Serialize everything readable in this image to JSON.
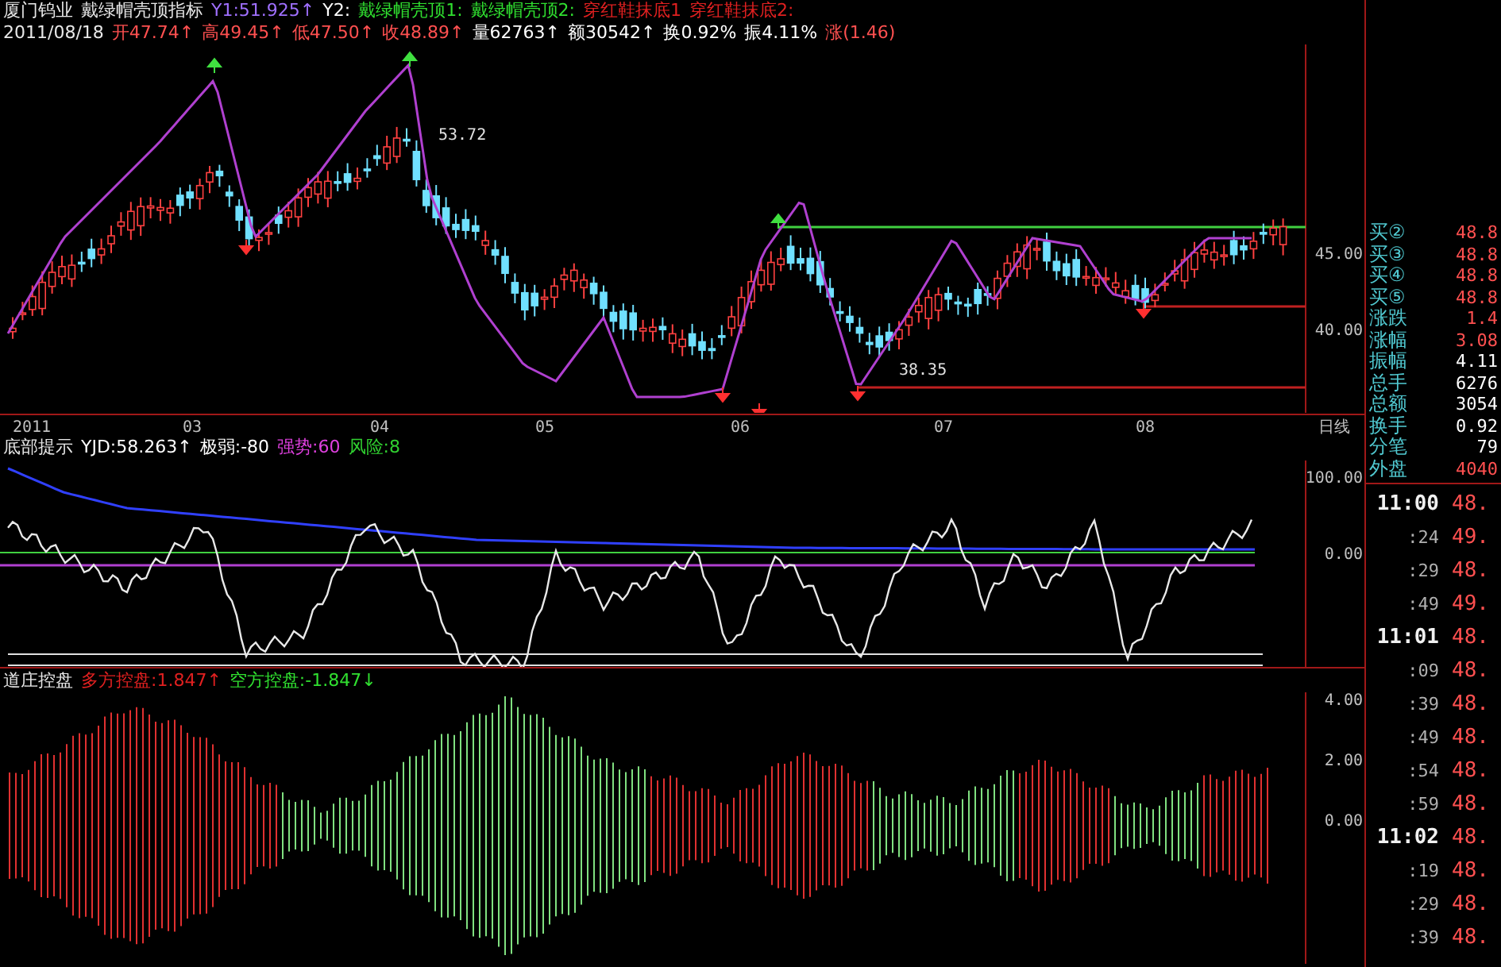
{
  "header": {
    "stock": "厦门钨业",
    "indicator": "戴绿帽壳顶指标",
    "items": [
      {
        "text": "Y1:51.925↑",
        "color": "#a070ff"
      },
      {
        "text": "Y2:",
        "color": "#ffffff"
      },
      {
        "text": "戴绿帽壳顶1:",
        "color": "#30e030"
      },
      {
        "text": "戴绿帽壳顶2:",
        "color": "#30e030"
      },
      {
        "text": "穿红鞋抹底1",
        "color": "#e02020"
      },
      {
        "text": "穿红鞋抹底2:",
        "color": "#e02020"
      }
    ]
  },
  "quote": {
    "date": "2011/08/18",
    "items": [
      {
        "text": "开47.74↑",
        "color": "#ff5050"
      },
      {
        "text": "高49.45↑",
        "color": "#ff5050"
      },
      {
        "text": "低47.50↑",
        "color": "#ff5050"
      },
      {
        "text": "收48.89↑",
        "color": "#ff5050"
      },
      {
        "text": "量62763↑",
        "color": "#ffffff"
      },
      {
        "text": "额30542↑",
        "color": "#ffffff"
      },
      {
        "text": "换0.92%",
        "color": "#ffffff"
      },
      {
        "text": "振4.11%",
        "color": "#ffffff"
      },
      {
        "text": "涨(1.46)",
        "color": "#ff5050"
      }
    ]
  },
  "price_chart": {
    "yticks": [
      "45.00",
      "40.00"
    ],
    "annotations": [
      "53.72",
      "38.35"
    ],
    "xlabels": [
      "2011",
      "03",
      "04",
      "05",
      "06",
      "07",
      "08"
    ],
    "period": "日线"
  },
  "indicator1": {
    "name": "底部提示",
    "items": [
      {
        "text": "YJD:58.263↑",
        "color": "#ffffff"
      },
      {
        "text": "极弱:-80",
        "color": "#ffffff"
      },
      {
        "text": "强势:60",
        "color": "#e040e0"
      },
      {
        "text": "风险:8",
        "color": "#30d030"
      }
    ],
    "yticks": [
      "100.00",
      "0.00"
    ]
  },
  "indicator2": {
    "name": "道庄控盘",
    "items": [
      {
        "text": "多方控盘:1.847↑",
        "color": "#e02020"
      },
      {
        "text": "空方控盘:-1.847↓",
        "color": "#30e030"
      }
    ],
    "yticks": [
      "4.00",
      "2.00",
      "0.00"
    ]
  },
  "quote_panel": {
    "rows": [
      {
        "label": "买②",
        "value": "48.8",
        "color": "#ff5050"
      },
      {
        "label": "买③",
        "value": "48.8",
        "color": "#ff5050"
      },
      {
        "label": "买④",
        "value": "48.8",
        "color": "#ff5050"
      },
      {
        "label": "买⑤",
        "value": "48.8",
        "color": "#ff5050"
      },
      {
        "label": "涨跌",
        "value": "1.4",
        "color": "#ff5050"
      },
      {
        "label": "涨幅",
        "value": "3.08",
        "color": "#ff5050"
      },
      {
        "label": "振幅",
        "value": "4.11",
        "color": "#ffffff"
      },
      {
        "label": "总手",
        "value": "6276",
        "color": "#ffffff"
      },
      {
        "label": "总额",
        "value": "3054",
        "color": "#ffffff"
      },
      {
        "label": "换手",
        "value": "0.92",
        "color": "#ffffff"
      },
      {
        "label": "分笔",
        "value": "79",
        "color": "#ffffff"
      },
      {
        "label": "外盘",
        "value": "4040",
        "color": "#ff5050"
      }
    ],
    "ticks": [
      {
        "time": "11:00",
        "price": "48.",
        "kind": "minute"
      },
      {
        "time": ":24",
        "price": "49.",
        "kind": "second"
      },
      {
        "time": ":29",
        "price": "48.",
        "kind": "second"
      },
      {
        "time": ":49",
        "price": "49.",
        "kind": "second"
      },
      {
        "time": "11:01",
        "price": "48.",
        "kind": "minute"
      },
      {
        "time": ":09",
        "price": "48.",
        "kind": "second"
      },
      {
        "time": ":39",
        "price": "48.",
        "kind": "second"
      },
      {
        "time": ":49",
        "price": "48.",
        "kind": "second"
      },
      {
        "time": ":54",
        "price": "48.",
        "kind": "second"
      },
      {
        "time": ":59",
        "price": "48.",
        "kind": "second"
      },
      {
        "time": "11:02",
        "price": "48.",
        "kind": "minute"
      },
      {
        "time": ":19",
        "price": "48.",
        "kind": "second"
      },
      {
        "time": ":29",
        "price": "48.",
        "kind": "second"
      },
      {
        "time": ":39",
        "price": "48.",
        "kind": "second"
      }
    ]
  }
}
